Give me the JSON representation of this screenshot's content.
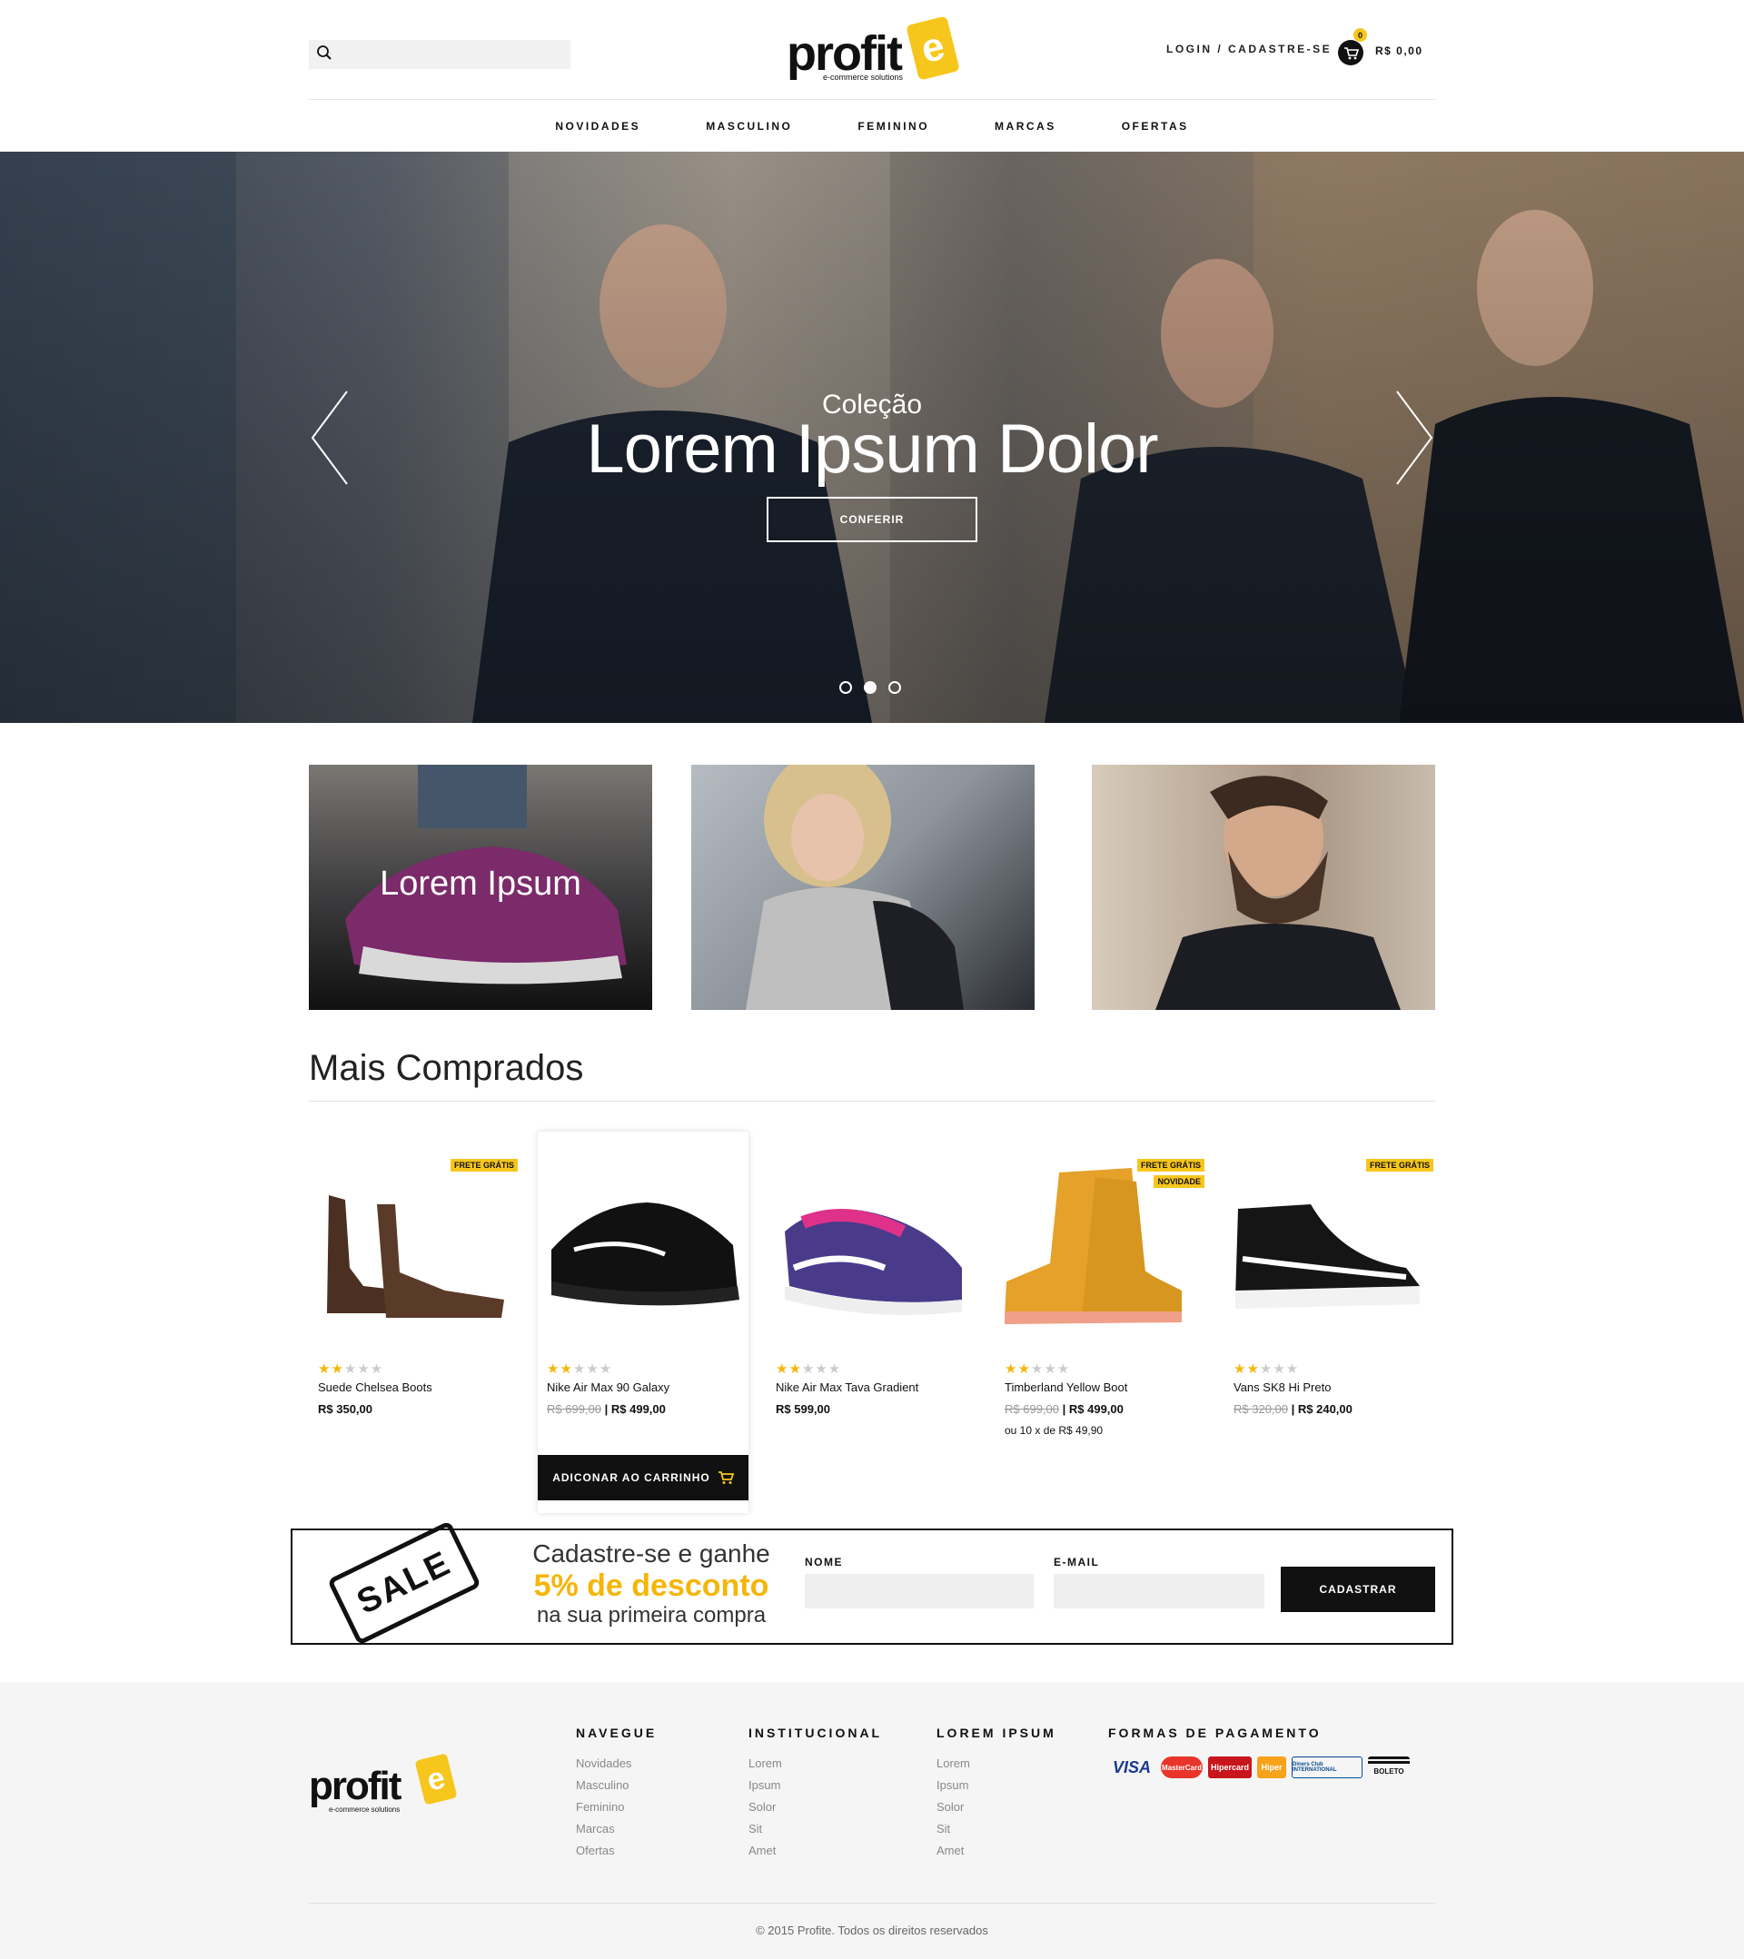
{
  "header": {
    "search_placeholder": "",
    "logo_text": "profit",
    "logo_letter": "e",
    "logo_tagline": "e-commerce solutions",
    "login_label": "LOGIN / CADASTRE-SE",
    "cart_count": "0",
    "cart_total": "R$ 0,00"
  },
  "nav": [
    "NOVIDADES",
    "MASCULINO",
    "FEMININO",
    "MARCAS",
    "OFERTAS"
  ],
  "hero": {
    "subtitle": "Coleção",
    "title": "Lorem Ipsum Dolor",
    "button": "CONFERIR",
    "slides": 3,
    "active_slide": 2
  },
  "tiles": [
    {
      "label": "Lorem Ipsum"
    },
    {
      "label": ""
    },
    {
      "label": ""
    }
  ],
  "section_title": "Mais Comprados",
  "products": [
    {
      "name": "Suede Chelsea Boots",
      "price": "R$ 350,00",
      "old_price": "",
      "rating": 2,
      "badges": [
        "FRETE GRÁTIS"
      ],
      "installments": ""
    },
    {
      "name": "Nike Air Max 90 Galaxy",
      "price": "R$ 499,00",
      "old_price": "R$ 699,00",
      "rating": 2,
      "badges": [],
      "installments": ""
    },
    {
      "name": "Nike Air Max Tava Gradient",
      "price": "R$ 599,00",
      "old_price": "",
      "rating": 2,
      "badges": [],
      "installments": ""
    },
    {
      "name": "Timberland Yellow Boot",
      "price": "R$ 499,00",
      "old_price": "R$ 699,00",
      "rating": 2,
      "badges": [
        "FRETE GRÁTIS",
        "NOVIDADE"
      ],
      "installments": "ou 10 x de R$ 49,90"
    },
    {
      "name": "Vans SK8 Hi Preto",
      "price": "R$ 240,00",
      "old_price": "R$ 320,00",
      "rating": 2,
      "badges": [
        "FRETE GRÁTIS"
      ],
      "installments": ""
    }
  ],
  "add_to_cart": "ADICONAR AO CARRINHO",
  "newsletter": {
    "sale_tag": "SALE",
    "line1": "Cadastre-se e ganhe",
    "line2": "5% de desconto",
    "line3": "na sua primeira compra",
    "name_label": "NOME",
    "email_label": "E-MAIL",
    "button": "CADASTRAR"
  },
  "footer": {
    "cols": [
      {
        "title": "NAVEGUE",
        "links": [
          "Novidades",
          "Masculino",
          "Feminino",
          "Marcas",
          "Ofertas"
        ]
      },
      {
        "title": "INSTITUCIONAL",
        "links": [
          "Lorem",
          "Ipsum",
          "Solor",
          "Sit",
          "Amet"
        ]
      },
      {
        "title": "LOREM IPSUM",
        "links": [
          "Lorem",
          "Ipsum",
          "Solor",
          "Sit",
          "Amet"
        ]
      }
    ],
    "payment_title": "FORMAS DE PAGAMENTO",
    "payments": [
      "VISA",
      "MasterCard",
      "Hipercard",
      "Hiper",
      "Diners Club INTERNATIONAL",
      "BOLETO"
    ],
    "copyright": "© 2015  Profite.  Todos os direitos reservados"
  },
  "colors": {
    "accent": "#f5b60a",
    "dark": "#111111",
    "footer_bg": "#f5f5f5"
  }
}
